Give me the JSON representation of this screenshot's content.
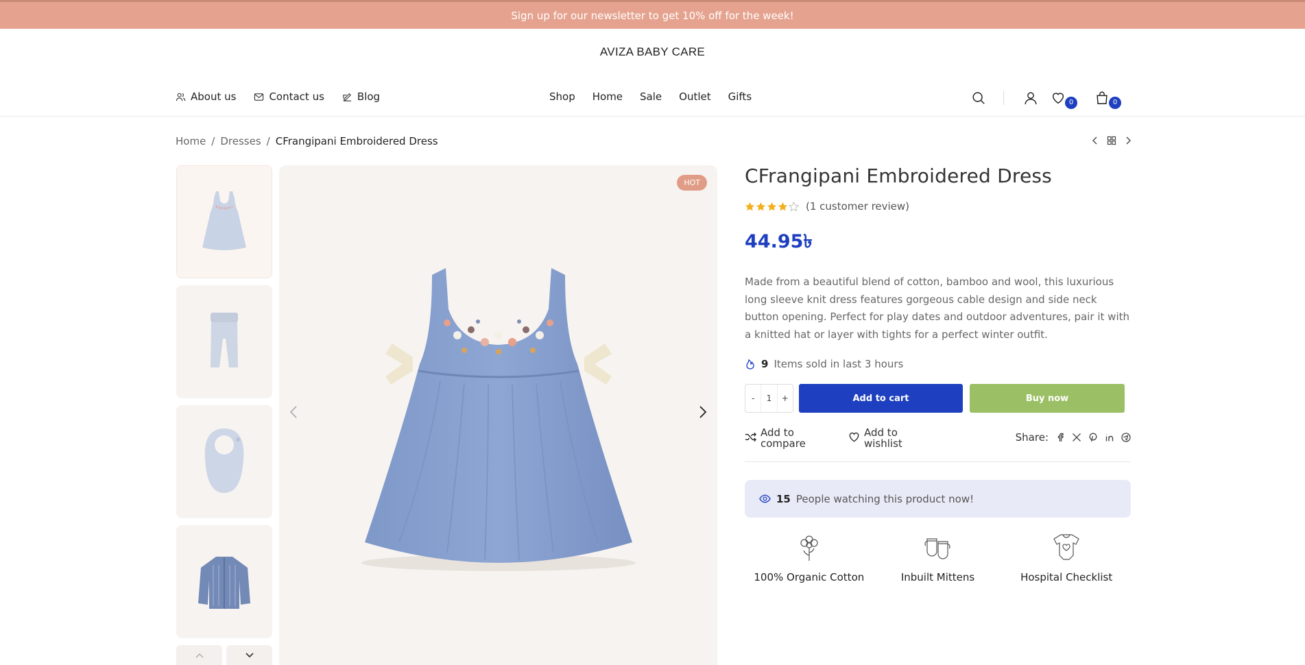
{
  "announcement": "Sign up for our newsletter to get 10% off for the week!",
  "brand": "AVIZA BABY CARE",
  "nav": {
    "left": [
      {
        "label": "About us",
        "icon": "users-icon"
      },
      {
        "label": "Contact us",
        "icon": "envelope-icon"
      },
      {
        "label": "Blog",
        "icon": "pencil-icon"
      }
    ],
    "center": [
      "Shop",
      "Home",
      "Sale",
      "Outlet",
      "Gifts"
    ],
    "wishlist_count": "0",
    "cart_count": "0"
  },
  "breadcrumb": [
    "Home",
    "Dresses",
    "CFrangipani Embroidered Dress"
  ],
  "product": {
    "badge": "HOT",
    "title": "CFrangipani Embroidered Dress",
    "rating": 4,
    "rating_max": 5,
    "review_text": "(1 customer review)",
    "price": "44.95৳",
    "description": "Made from a beautiful blend of cotton, bamboo and wool, this luxurious long sleeve knit dress features gorgeous cable design and side neck button opening. Perfect for play dates and outdoor adventures, pair it with a knitted hat or layer with tights for a perfect winter outfit.",
    "sold_count": "9",
    "sold_text": "Items sold in last 3 hours",
    "quantity": "1",
    "qty_minus": "-",
    "qty_plus": "+",
    "add_to_cart": "Add to cart",
    "buy_now": "Buy now",
    "compare_line1": "Add to",
    "compare_line2": "compare",
    "wishlist_line1": "Add to",
    "wishlist_line2": "wishlist",
    "share_label": "Share:",
    "watching_count": "15",
    "watching_text": "People watching this product now!",
    "features": [
      {
        "label": "100% Organic Cotton",
        "icon": "cotton-flower-icon"
      },
      {
        "label": "Inbuilt Mittens",
        "icon": "mittens-icon"
      },
      {
        "label": "Hospital Checklist",
        "icon": "onesie-icon"
      }
    ]
  },
  "colors": {
    "announcement_bg": "#e5a38f",
    "accent_blue": "#1e3fbf",
    "buy_green": "#9bbf65",
    "star_yellow": "#f2b01e",
    "watching_bg": "#e8ebf7"
  }
}
